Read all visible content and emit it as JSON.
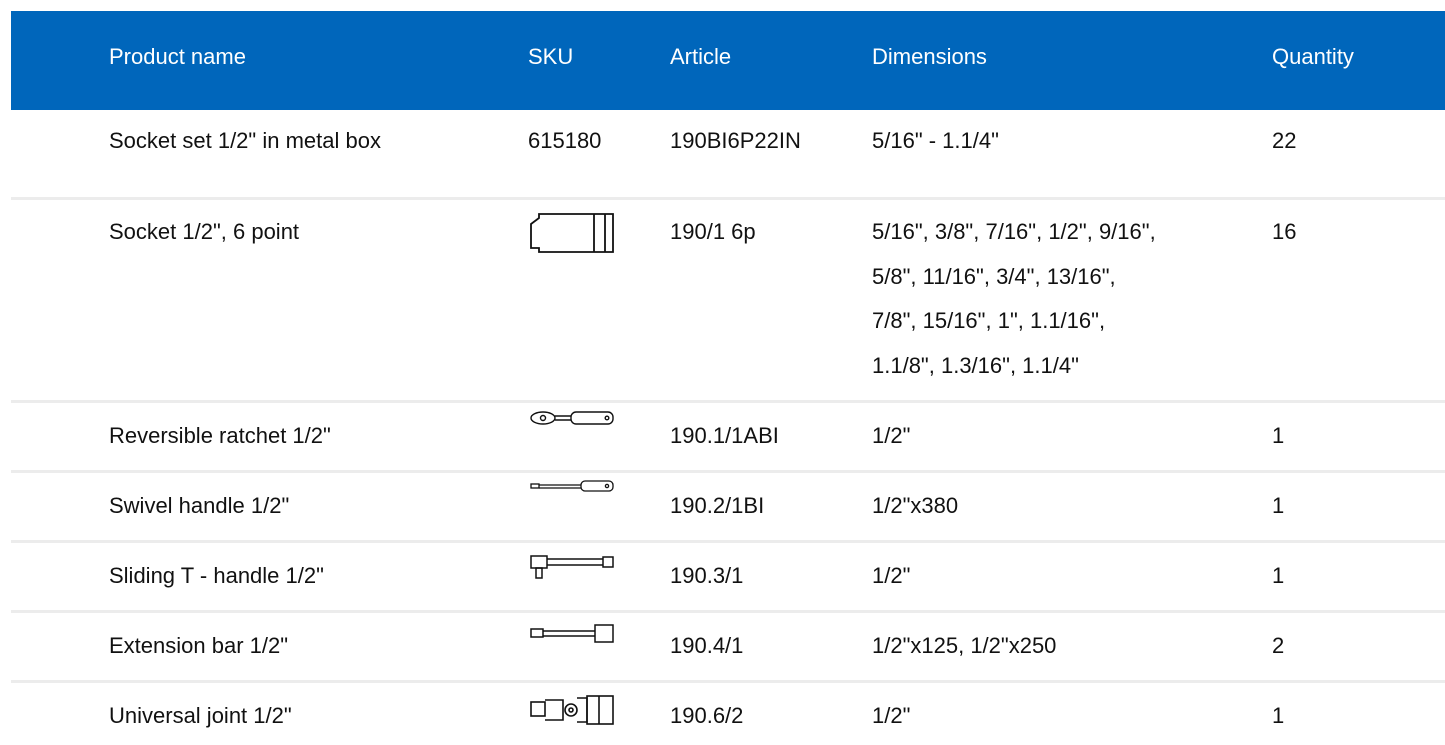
{
  "columns": {
    "product_name": "Product name",
    "sku": "SKU",
    "article": "Article",
    "dimensions": "Dimensions",
    "quantity": "Quantity"
  },
  "rows": [
    {
      "name": "Socket set 1/2\" in metal box",
      "sku": "615180",
      "article": "190BI6P22IN",
      "dimensions": [
        "5/16\" - 1.1/4\""
      ],
      "quantity": "22"
    },
    {
      "name": "Socket 1/2\", 6 point",
      "sku_icon": "socket-icon",
      "article": "190/1 6p",
      "dimensions": [
        "5/16\", 3/8\", 7/16\", 1/2\", 9/16\",",
        "5/8\", 11/16\", 3/4\", 13/16\",",
        "7/8\", 15/16\", 1\", 1.1/16\",",
        "1.1/8\", 1.3/16\", 1.1/4\""
      ],
      "quantity": "16"
    },
    {
      "name": "Reversible ratchet 1/2\"",
      "sku_icon": "ratchet-icon",
      "article": "190.1/1ABI",
      "dimensions": [
        "1/2\""
      ],
      "quantity": "1"
    },
    {
      "name": "Swivel handle 1/2\"",
      "sku_icon": "swivel-handle-icon",
      "article": "190.2/1BI",
      "dimensions": [
        "1/2\"x380"
      ],
      "quantity": "1"
    },
    {
      "name": "Sliding T - handle 1/2\"",
      "sku_icon": "t-handle-icon",
      "article": "190.3/1",
      "dimensions": [
        "1/2\""
      ],
      "quantity": "1"
    },
    {
      "name": "Extension bar 1/2\"",
      "sku_icon": "extension-bar-icon",
      "article": "190.4/1",
      "dimensions": [
        "1/2\"x125, 1/2\"x250"
      ],
      "quantity": "2"
    },
    {
      "name": "Universal joint 1/2\"",
      "sku_icon": "universal-joint-icon",
      "article": "190.6/2",
      "dimensions": [
        "1/2\""
      ],
      "quantity": "1"
    }
  ],
  "colors": {
    "header_bg": "#0066bb",
    "header_text": "#ffffff",
    "row_divider": "#ececec"
  }
}
